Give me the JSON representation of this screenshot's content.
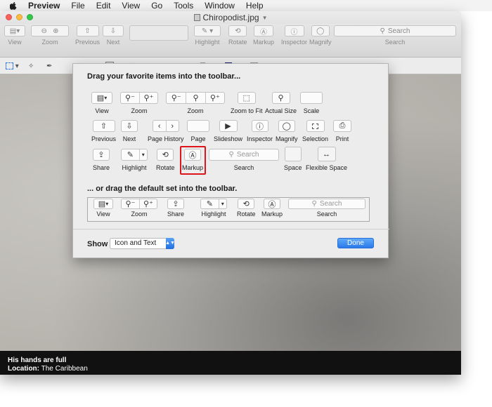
{
  "menubar": {
    "items": [
      "Preview",
      "File",
      "Edit",
      "View",
      "Go",
      "Tools",
      "Window",
      "Help"
    ]
  },
  "window": {
    "title": "Chiropodist.jpg"
  },
  "toolbar": {
    "labels": {
      "view": "View",
      "zoom": "Zoom",
      "previous": "Previous",
      "next": "Next",
      "highlight": "Highlight",
      "rotate": "Rotate",
      "markup": "Markup",
      "inspector": "Inspector",
      "magnify": "Magnify",
      "search": "Search"
    },
    "search_placeholder": "Search"
  },
  "sheet": {
    "heading": "Drag your favorite items into the toolbar...",
    "palette": [
      {
        "label": "View"
      },
      {
        "label": "Zoom"
      },
      {
        "label": "Zoom"
      },
      {
        "label": "Zoom to Fit"
      },
      {
        "label": "Actual Size"
      },
      {
        "label": "Scale"
      },
      {
        "label": "Previous"
      },
      {
        "label": "Next"
      },
      {
        "label": "Page History"
      },
      {
        "label": "Page"
      },
      {
        "label": "Slideshow"
      },
      {
        "label": "Inspector"
      },
      {
        "label": "Magnify"
      },
      {
        "label": "Selection"
      },
      {
        "label": "Print"
      },
      {
        "label": "Share"
      },
      {
        "label": "Highlight"
      },
      {
        "label": "Rotate"
      },
      {
        "label": "Markup"
      },
      {
        "label": "Search"
      },
      {
        "label": "Space"
      },
      {
        "label": "Flexible Space"
      }
    ],
    "search_placeholder": "Search",
    "default_heading": "... or drag the default set into the toolbar.",
    "default_set": [
      {
        "label": "View"
      },
      {
        "label": "Zoom"
      },
      {
        "label": "Share"
      },
      {
        "label": "Highlight"
      },
      {
        "label": "Rotate"
      },
      {
        "label": "Markup"
      },
      {
        "label": "Search"
      }
    ],
    "show_label": "Show",
    "show_value": "Icon and Text",
    "done_label": "Done"
  },
  "caption": {
    "line1": "His hands are full",
    "location_label": "Location:",
    "location_value": "The Caribbean"
  },
  "colors": {
    "accent": "#2a79ea",
    "highlight_border": "#e0141d",
    "close": "#fc605c",
    "minimize": "#fdbc40",
    "zoom": "#34c84a"
  }
}
